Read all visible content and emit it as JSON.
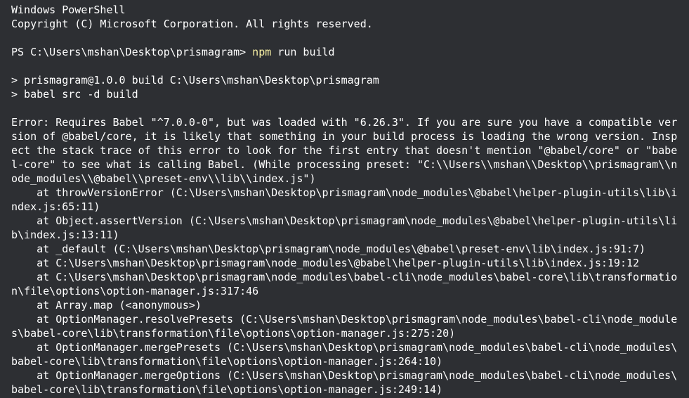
{
  "window": {
    "title": "Windows PowerShell"
  },
  "header": {
    "line1": "Windows PowerShell",
    "line2": "Copyright (C) Microsoft Corporation. All rights reserved."
  },
  "prompt": {
    "path": "PS C:\\Users\\mshan\\Desktop\\prismagram> ",
    "command_exec": "npm",
    "command_args": " run build"
  },
  "npm_output": [
    "> prismagram@1.0.0 build C:\\Users\\mshan\\Desktop\\prismagram",
    "> babel src -d build"
  ],
  "error_lines": [
    "Error: Requires Babel \"^7.0.0-0\", but was loaded with \"6.26.3\". If you are sure you have a compatible ver",
    "sion of @babel/core, it is likely that something in your build process is loading the wrong version. Insp",
    "ect the stack trace of this error to look for the first entry that doesn't mention \"@babel/core\" or \"babe",
    "l-core\" to see what is calling Babel. (While processing preset: \"C:\\\\Users\\\\mshan\\\\Desktop\\\\prismagram\\\\n",
    "ode_modules\\\\@babel\\\\preset-env\\\\lib\\\\index.js\")",
    "    at throwVersionError (C:\\Users\\mshan\\Desktop\\prismagram\\node_modules\\@babel\\helper-plugin-utils\\lib\\i",
    "ndex.js:65:11)",
    "    at Object.assertVersion (C:\\Users\\mshan\\Desktop\\prismagram\\node_modules\\@babel\\helper-plugin-utils\\li",
    "b\\index.js:13:11)",
    "    at _default (C:\\Users\\mshan\\Desktop\\prismagram\\node_modules\\@babel\\preset-env\\lib\\index.js:91:7)",
    "    at C:\\Users\\mshan\\Desktop\\prismagram\\node_modules\\@babel\\helper-plugin-utils\\lib\\index.js:19:12",
    "    at C:\\Users\\mshan\\Desktop\\prismagram\\node_modules\\babel-cli\\node_modules\\babel-core\\lib\\transformatio",
    "n\\file\\options\\option-manager.js:317:46",
    "    at Array.map (<anonymous>)",
    "    at OptionManager.resolvePresets (C:\\Users\\mshan\\Desktop\\prismagram\\node_modules\\babel-cli\\node_module",
    "s\\babel-core\\lib\\transformation\\file\\options\\option-manager.js:275:20)",
    "    at OptionManager.mergePresets (C:\\Users\\mshan\\Desktop\\prismagram\\node_modules\\babel-cli\\node_modules\\",
    "babel-core\\lib\\transformation\\file\\options\\option-manager.js:264:10)",
    "    at OptionManager.mergeOptions (C:\\Users\\mshan\\Desktop\\prismagram\\node_modules\\babel-cli\\node_modules\\",
    "babel-core\\lib\\transformation\\file\\options\\option-manager.js:249:14)"
  ],
  "colors": {
    "background": "#2d2f33",
    "text": "#ffffff",
    "command": "#f9f1a5"
  }
}
